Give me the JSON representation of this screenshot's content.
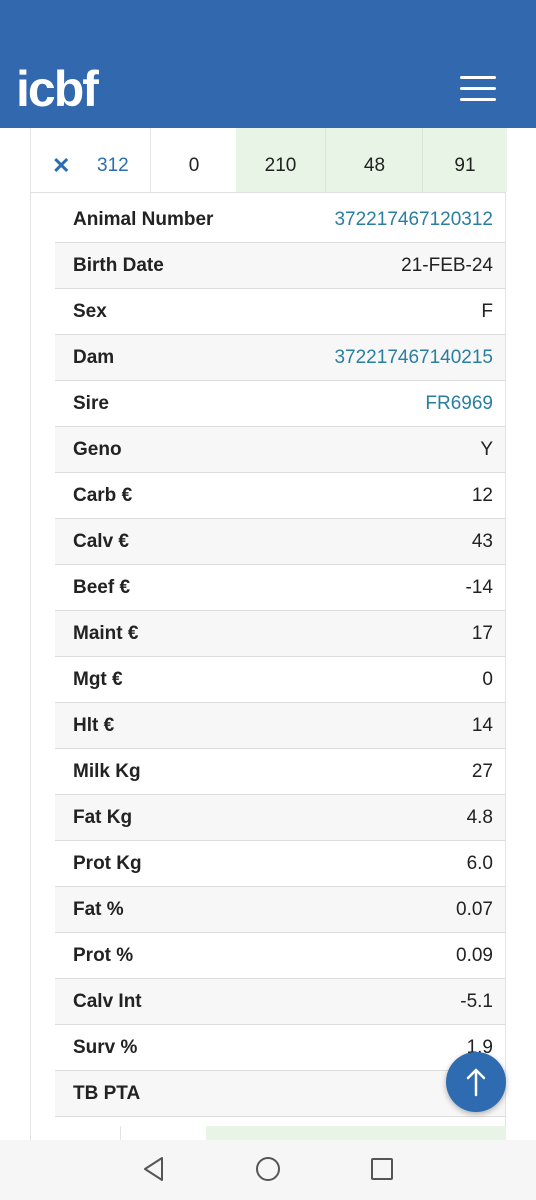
{
  "header": {
    "logo_text": "icbf",
    "menu_icon": "hamburger-menu-icon",
    "background": "#3268ad"
  },
  "summary": {
    "close_icon": "close-icon",
    "animal_short": "312",
    "col2": "0",
    "col3": "210",
    "col4": "48",
    "col5": "91"
  },
  "details": [
    {
      "label": "Animal Number",
      "value": "372217467120312",
      "link": true
    },
    {
      "label": "Birth Date",
      "value": "21-FEB-24",
      "link": false
    },
    {
      "label": "Sex",
      "value": "F",
      "link": false
    },
    {
      "label": "Dam",
      "value": "372217467140215",
      "link": true
    },
    {
      "label": "Sire",
      "value": "FR6969",
      "link": true
    },
    {
      "label": "Geno",
      "value": "Y",
      "link": false
    },
    {
      "label": "Carb €",
      "value": "12",
      "link": false
    },
    {
      "label": "Calv €",
      "value": "43",
      "link": false
    },
    {
      "label": "Beef €",
      "value": "-14",
      "link": false
    },
    {
      "label": "Maint €",
      "value": "17",
      "link": false
    },
    {
      "label": "Mgt €",
      "value": "0",
      "link": false
    },
    {
      "label": "Hlt €",
      "value": "14",
      "link": false
    },
    {
      "label": "Milk Kg",
      "value": "27",
      "link": false
    },
    {
      "label": "Fat Kg",
      "value": "4.8",
      "link": false
    },
    {
      "label": "Prot Kg",
      "value": "6.0",
      "link": false
    },
    {
      "label": "Fat %",
      "value": "0.07",
      "link": false
    },
    {
      "label": "Prot %",
      "value": "0.09",
      "link": false
    },
    {
      "label": "Calv Int",
      "value": "-5.1",
      "link": false
    },
    {
      "label": "Surv %",
      "value": "1.9",
      "link": false
    },
    {
      "label": "TB PTA",
      "value": "",
      "link": false
    }
  ],
  "fab": {
    "icon": "arrow-up-icon"
  },
  "navbar": {
    "back_icon": "back-triangle-icon",
    "home_icon": "home-circle-icon",
    "recents_icon": "recents-square-icon"
  },
  "colors": {
    "brand": "#3268ad",
    "link": "#2a7ea0",
    "green_cell": "#e8f5e6"
  }
}
